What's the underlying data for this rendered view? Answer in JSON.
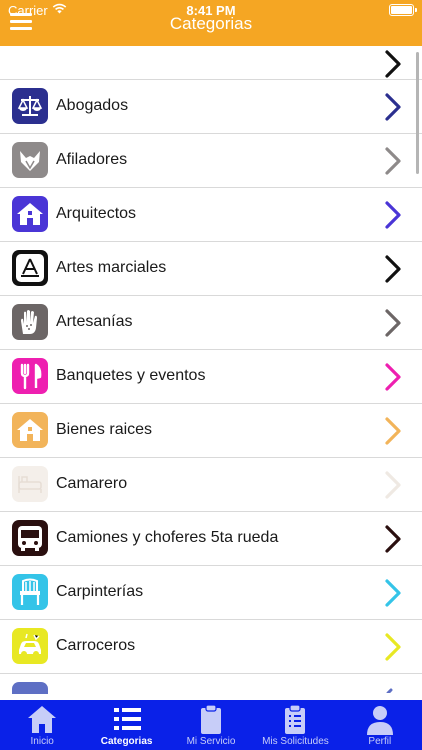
{
  "status_bar": {
    "carrier": "Carrier",
    "time": "8:41 PM"
  },
  "header": {
    "title": "Categorias"
  },
  "categories": [
    {
      "label": "Abogados",
      "icon": "scales-icon",
      "color": "#2b2f8f"
    },
    {
      "label": "Afiladores",
      "icon": "fox-icon",
      "color": "#8e8a8a"
    },
    {
      "label": "Arquitectos",
      "icon": "house-icon",
      "color": "#4a35d6"
    },
    {
      "label": "Artes marciales",
      "icon": "app-store-a-icon",
      "color": "#111111"
    },
    {
      "label": "Artesanías",
      "icon": "hand-icon",
      "color": "#6c6666"
    },
    {
      "label": "Banquetes y eventos",
      "icon": "cutlery-icon",
      "color": "#ee1fb0"
    },
    {
      "label": "Bienes raices",
      "icon": "house-icon",
      "color": "#f2b45a"
    },
    {
      "label": "Camarero",
      "icon": "bed-icon",
      "color": "#f4efea"
    },
    {
      "label": "Camiones y choferes 5ta rueda",
      "icon": "bus-icon",
      "color": "#2a0f0f"
    },
    {
      "label": "Carpinterías",
      "icon": "chair-icon",
      "color": "#34c4e8"
    },
    {
      "label": "Carroceros",
      "icon": "car-icon",
      "color": "#e8e823"
    }
  ],
  "partial_row": {
    "color": "#5e6fc4"
  },
  "tabs": [
    {
      "label": "Inicio",
      "icon": "home-icon",
      "active": false
    },
    {
      "label": "Categorias",
      "icon": "list-icon",
      "active": true
    },
    {
      "label": "Mi Servicio",
      "icon": "clipboard-icon",
      "active": false
    },
    {
      "label": "Mis Solicitudes",
      "icon": "checklist-clipboard-icon",
      "active": false
    },
    {
      "label": "Perfil",
      "icon": "person-icon",
      "active": false
    }
  ]
}
